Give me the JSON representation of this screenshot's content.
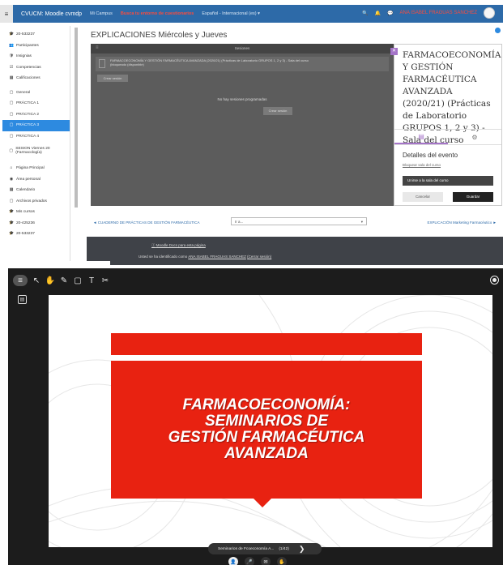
{
  "moodle": {
    "nav": {
      "toggle": "≡",
      "brand": "CVUCM: Moodle cvmdp",
      "links": [
        "Mi Campus",
        "Busca tu entorno de cuestionarios",
        "Español - Internacional (es) ▾"
      ],
      "user": "ANA ISABEL FRAGUAS SANCHEZ"
    },
    "sidebar": {
      "items": [
        {
          "icon": "🎓",
          "label": "20-533237"
        },
        {
          "icon": "👥",
          "label": "Participantes"
        },
        {
          "icon": "🛡",
          "label": "Insignias"
        },
        {
          "icon": "☑",
          "label": "Competencias"
        },
        {
          "icon": "▦",
          "label": "Calificaciones"
        },
        {
          "icon": "▢",
          "label": "General"
        },
        {
          "icon": "▢",
          "label": "PRÁCTICA 1"
        },
        {
          "icon": "▢",
          "label": "PRÁCTICA 2"
        },
        {
          "icon": "▢",
          "label": "PRÁCTICA 3"
        },
        {
          "icon": "▢",
          "label": "PRÁCTICA 4"
        },
        {
          "icon": "▢",
          "label": "SESION Viernes 20 (Farmacología)"
        },
        {
          "icon": "⌂",
          "label": "Página Principal"
        },
        {
          "icon": "◉",
          "label": "Área personal"
        },
        {
          "icon": "▦",
          "label": "Calendario"
        },
        {
          "icon": "▢",
          "label": "Archivos privados"
        },
        {
          "icon": "🎓",
          "label": "Mis cursos"
        },
        {
          "icon": "🎓",
          "label": "20-425236"
        },
        {
          "icon": "🎓",
          "label": "20-533237"
        }
      ]
    },
    "page_title": "EXPLICACIONES Miércoles y Jueves",
    "sessions": {
      "header": "Sesiones",
      "course_line": "FARMACOECONOMÍA Y GESTIÓN FARMACÉUTICA AVANZADA (2020/21) (Prácticas de Laboratorio GRUPOS 1, 2 y 3) - Sala del curso",
      "course_sub": "(bloqueado (disponible)",
      "create_btn": "Crear sesión",
      "no_sessions": "No hay sesiones programadas",
      "create_btn_center": "Crear sesión"
    },
    "event": {
      "title": "FARMACOECONOMÍA Y GESTIÓN FARMACÉUTICA AVANZADA (2020/21) (Prácticas de Laboratorio GRUPOS 1, 2 y 3) - Sala del curso",
      "details": "Detalles del evento",
      "bloquear": "Bloquear sala del curso",
      "join": "Unirse a la sala del curso",
      "cancel": "Cancelar",
      "save": "Guardar"
    },
    "footer_nav": {
      "prev": "◄ CUADERNO DE PRÁCTICAS DE GESTIÓN FARMACÉUTICA",
      "select": "Ir a...",
      "next": "EXPLICACIÓN Marketing Farmacéutico ►"
    },
    "footer": {
      "docs": "Moodle Docs para esta página",
      "login_prefix": "Usted se ha identificado como ",
      "login_user": "ANA ISABEL FRAGUAS SANCHEZ",
      "logout": "(Cerrar sesión)"
    }
  },
  "bbb": {
    "tools": [
      "≡",
      "↖",
      "✋",
      "✎",
      "▢",
      "T",
      "✂"
    ],
    "slide": {
      "title_lines": [
        "FARMACOECONOMÍA:",
        "SEMINARIOS DE",
        "GESTIÓN FARMACÉUTICA",
        "AVANZADA"
      ],
      "accent": "#e82211"
    },
    "slide_nav": {
      "label": "Seminarios de Fcoeconomía A...",
      "pages": "(1/42)",
      "next": "❯"
    },
    "controls": [
      "👤",
      "🎤",
      "✉",
      "✋"
    ]
  }
}
